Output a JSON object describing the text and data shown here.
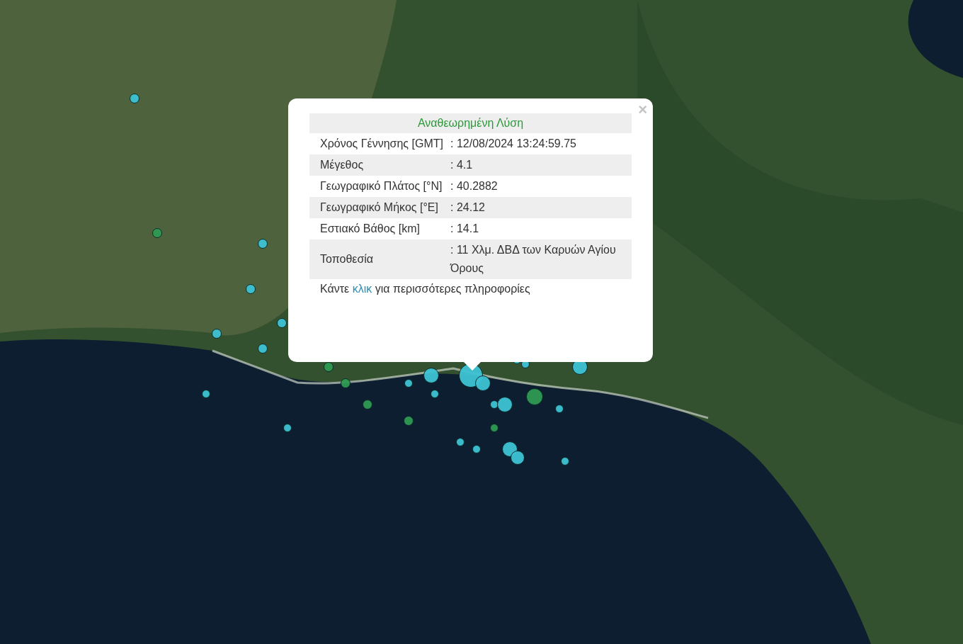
{
  "markers": [
    {
      "color": "#3ec3d4"
    },
    {
      "color": "#2f9a52"
    },
    {
      "color": "#3ec3d4"
    },
    {
      "color": "#3ec3d4"
    },
    {
      "color": "#3ec3d4"
    },
    {
      "color": "#3ec3d4"
    },
    {
      "color": "#3ec3d4"
    },
    {
      "color": "#2f9a52"
    },
    {
      "color": "#2f9a52"
    },
    {
      "color": "#3ec3d4"
    },
    {
      "color": "#3ec3d4"
    },
    {
      "color": "#2f9a52"
    },
    {
      "color": "#2f9a52"
    },
    {
      "color": "#3ec3d4"
    },
    {
      "color": "#3ec3d4"
    },
    {
      "color": "#3ec3d4"
    },
    {
      "color": "#3ec3d4"
    },
    {
      "color": "#3ec3d4"
    },
    {
      "color": "#3ec3d4"
    },
    {
      "color": "#3ec3d4"
    },
    {
      "color": "#2f9a52"
    },
    {
      "color": "#3ec3d4"
    },
    {
      "color": "#2f9a52"
    },
    {
      "color": "#3ec3d4"
    },
    {
      "color": "#3ec3d4"
    },
    {
      "color": "#3ec3d4"
    },
    {
      "color": "#3ec3d4"
    },
    {
      "color": "#3ec3d4"
    },
    {
      "color": "#3ec3d4"
    },
    {
      "color": "#3ec3d4"
    },
    {
      "color": "#3ec3d4"
    }
  ],
  "popup": {
    "close": "×",
    "title": "Αναθεωρημένη Λύση",
    "rows": [
      {
        "label": "Χρόνος Γέννησης [GMT]",
        "value": ": 12/08/2024 13:24:59.75"
      },
      {
        "label": "Μέγεθος",
        "value": ": 4.1"
      },
      {
        "label": "Γεωγραφικό Πλάτος [°N]",
        "value": ": 40.2882"
      },
      {
        "label": "Γεωγραφικό Μήκος [°E]",
        "value": ": 24.12"
      },
      {
        "label": "Εστιακό Βάθος [km]",
        "value": ": 14.1"
      },
      {
        "label": "Τοποθεσία",
        "value": ": 11 Χλμ. ΔΒΔ των Καρυών Αγίου Όρους"
      }
    ],
    "footer": {
      "before": "Κάντε ",
      "link": "κλικ",
      "after": " για περισσότερες πληροφορίες"
    }
  }
}
